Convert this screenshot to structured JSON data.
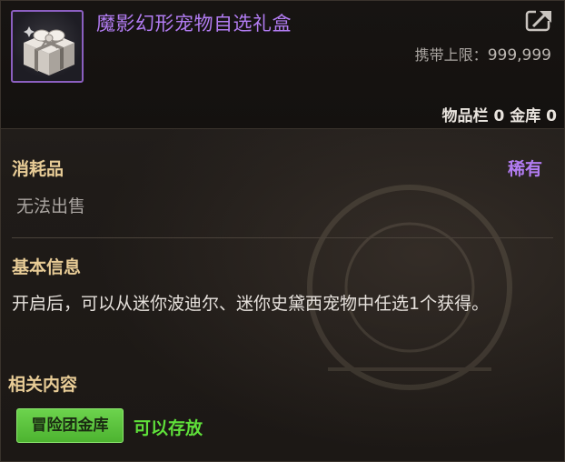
{
  "item": {
    "name": "魔影幻形宠物自选礼盒",
    "icon": "gift-box-icon",
    "carry_limit_label": "携带上限：",
    "carry_limit_value": "999,999",
    "inventory_label": "物品栏",
    "inventory_count": "0",
    "bank_label": "金库",
    "bank_count": "0"
  },
  "category": {
    "type": "消耗品",
    "rarity": "稀有",
    "sell_status": "无法出售"
  },
  "basic_info": {
    "title": "基本信息",
    "description": "开启后，可以从迷你波迪尔、迷你史黛西宠物中任选1个获得。"
  },
  "related": {
    "title": "相关内容",
    "tag_label": "冒险团金库",
    "tag_note": "可以存放"
  },
  "colors": {
    "rarity": "#b27cf2",
    "section_title": "#e8cc96",
    "tag_green": "#5fe03a"
  }
}
